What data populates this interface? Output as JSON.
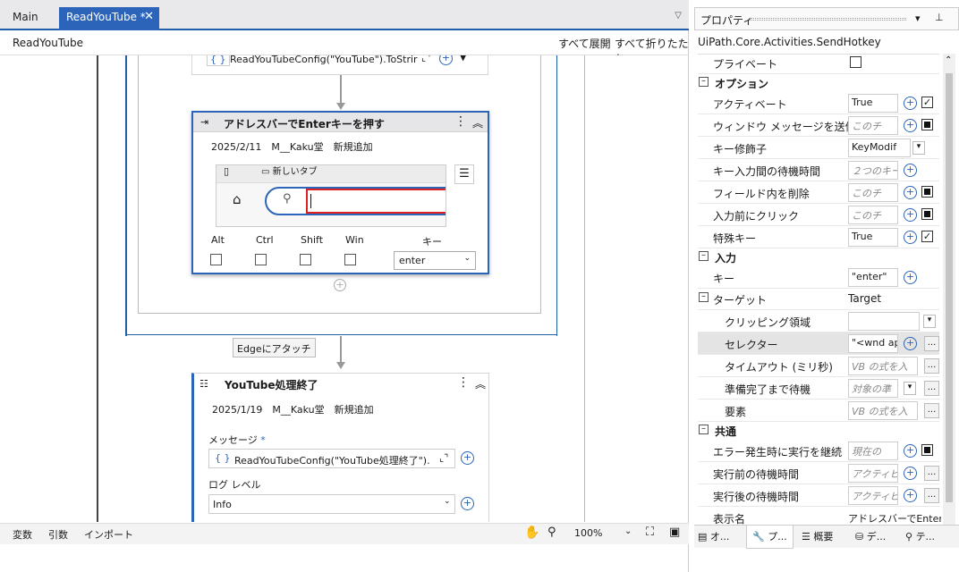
{
  "tabs": {
    "main": "Main",
    "active": "ReadYouTube *"
  },
  "workflow": {
    "title": "ReadYouTube",
    "expand_all": "すべて展開",
    "collapse_all": "すべて折りたたむ"
  },
  "top_activity": {
    "expr": "ReadYouTubeConfig(\"YouTube\").ToStrir"
  },
  "sendhotkey": {
    "title": "アドレスバーでEnterキーを押す",
    "annotation": "2025/2/11　M__Kaku堂　新規追加",
    "browser_tab": "新しいタブ",
    "labels": {
      "alt": "Alt",
      "ctrl": "Ctrl",
      "shift": "Shift",
      "win": "Win",
      "key": "キー"
    },
    "key_value": "enter"
  },
  "attach_label": "Edgeにアタッチ",
  "logmessage": {
    "title": "YouTube処理終了",
    "annotation": "2025/1/19　M__Kaku堂　新規追加",
    "message_label": "メッセージ",
    "required": "*",
    "message_expr": "ReadYouTubeConfig(\"YouTube処理終了\").",
    "loglevel_label": "ログ レベル",
    "loglevel_value": "Info"
  },
  "status": {
    "variables": "変数",
    "arguments": "引数",
    "imports": "インポート",
    "zoom": "100%"
  },
  "properties": {
    "panel_title": "プロパティ",
    "class_name": "UiPath.Core.Activities.SendHotkey",
    "rows": [
      {
        "label": "プライベート",
        "value": ""
      },
      {
        "label": "アクティベート",
        "value": "True"
      },
      {
        "label": "ウィンドウ メッセージを送信",
        "value": "このチ"
      },
      {
        "label": "キー修飾子",
        "value": "KeyModif"
      },
      {
        "label": "キー入力間の待機時間",
        "value": "２つのキー"
      },
      {
        "label": "フィールド内を削除",
        "value": "このチ"
      },
      {
        "label": "入力前にクリック",
        "value": "このチ"
      },
      {
        "label": "特殊キー",
        "value": "True"
      },
      {
        "label": "キー",
        "value": "\"enter\""
      },
      {
        "label": "ターゲット",
        "value": "Target"
      },
      {
        "label": "クリッピング領域",
        "value": ""
      },
      {
        "label": "セレクター",
        "value": "\"<wnd ap"
      },
      {
        "label": "タイムアウト (ミリ秒)",
        "value": "VB の式を入"
      },
      {
        "label": "準備完了まで待機",
        "value": "対象の準"
      },
      {
        "label": "要素",
        "value": "VB の式を入"
      },
      {
        "label": "エラー発生時に実行を継続",
        "value": "現在の"
      },
      {
        "label": "実行前の待機時間",
        "value": "アクティビ"
      },
      {
        "label": "実行後の待機時間",
        "value": "アクティビ"
      },
      {
        "label": "表示名",
        "value": "アドレスバーでEnterキ"
      }
    ],
    "categories": {
      "options": "オプション",
      "input": "入力",
      "common": "共通"
    },
    "bottom_tabs": [
      "オ...",
      "プ...",
      "概要",
      "デ...",
      "テ..."
    ]
  }
}
